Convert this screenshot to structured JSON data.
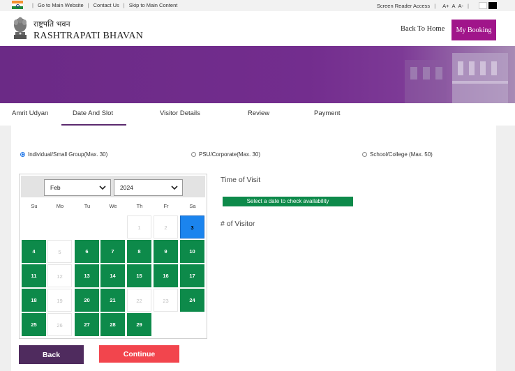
{
  "topbar": {
    "links": [
      "Go to Main Website",
      "Contact Us",
      "Skip to Main Content"
    ],
    "screen_reader": "Screen Reader Access",
    "font_sizes": [
      "A+",
      "A",
      "A-"
    ]
  },
  "header": {
    "brand_hindi": "राष्ट्रपति भवन",
    "brand_english": "RASHTRAPATI BHAVAN",
    "back_home": "Back To Home",
    "my_booking": "My Booking"
  },
  "tabs": [
    {
      "label": "Amrit Udyan",
      "active": false
    },
    {
      "label": "Date And Slot",
      "active": true
    },
    {
      "label": "Visitor Details",
      "active": false
    },
    {
      "label": "Review",
      "active": false
    },
    {
      "label": "Payment",
      "active": false
    }
  ],
  "visitor_types": [
    {
      "label": "Individual/Small Group(Max. 30)",
      "checked": true
    },
    {
      "label": "PSU/Corporate(Max. 30)",
      "checked": false
    },
    {
      "label": "School/College (Max. 50)",
      "checked": false
    }
  ],
  "calendar": {
    "month": "Feb",
    "year": "2024",
    "weekdays": [
      "Su",
      "Mo",
      "Tu",
      "We",
      "Th",
      "Fr",
      "Sa"
    ],
    "days": [
      {
        "day": "1",
        "status": "off",
        "col": 4,
        "row": 0
      },
      {
        "day": "2",
        "status": "off",
        "col": 5,
        "row": 0
      },
      {
        "day": "3",
        "status": "selected",
        "col": 6,
        "row": 0
      },
      {
        "day": "4",
        "status": "available",
        "col": 0,
        "row": 1
      },
      {
        "day": "5",
        "status": "off",
        "col": 1,
        "row": 1
      },
      {
        "day": "6",
        "status": "available",
        "col": 2,
        "row": 1
      },
      {
        "day": "7",
        "status": "available",
        "col": 3,
        "row": 1
      },
      {
        "day": "8",
        "status": "available",
        "col": 4,
        "row": 1
      },
      {
        "day": "9",
        "status": "available",
        "col": 5,
        "row": 1
      },
      {
        "day": "10",
        "status": "available",
        "col": 6,
        "row": 1
      },
      {
        "day": "11",
        "status": "available",
        "col": 0,
        "row": 2
      },
      {
        "day": "12",
        "status": "off",
        "col": 1,
        "row": 2
      },
      {
        "day": "13",
        "status": "available",
        "col": 2,
        "row": 2
      },
      {
        "day": "14",
        "status": "available",
        "col": 3,
        "row": 2
      },
      {
        "day": "15",
        "status": "available",
        "col": 4,
        "row": 2
      },
      {
        "day": "16",
        "status": "available",
        "col": 5,
        "row": 2
      },
      {
        "day": "17",
        "status": "available",
        "col": 6,
        "row": 2
      },
      {
        "day": "18",
        "status": "available",
        "col": 0,
        "row": 3
      },
      {
        "day": "19",
        "status": "off",
        "col": 1,
        "row": 3
      },
      {
        "day": "20",
        "status": "available",
        "col": 2,
        "row": 3
      },
      {
        "day": "21",
        "status": "available",
        "col": 3,
        "row": 3
      },
      {
        "day": "22",
        "status": "off",
        "col": 4,
        "row": 3
      },
      {
        "day": "23",
        "status": "off",
        "col": 5,
        "row": 3
      },
      {
        "day": "24",
        "status": "available",
        "col": 6,
        "row": 3
      },
      {
        "day": "25",
        "status": "available",
        "col": 0,
        "row": 4
      },
      {
        "day": "26",
        "status": "off",
        "col": 1,
        "row": 4
      },
      {
        "day": "27",
        "status": "available",
        "col": 2,
        "row": 4
      },
      {
        "day": "28",
        "status": "available",
        "col": 3,
        "row": 4
      },
      {
        "day": "29",
        "status": "available",
        "col": 4,
        "row": 4
      }
    ]
  },
  "slot": {
    "time_label": "Time of Visit",
    "availability_hint": "Select a date to check availability",
    "visitor_label": "# of Visitor"
  },
  "actions": {
    "back": "Back",
    "continue": "Continue"
  },
  "colors": {
    "brand_purple": "#a0158a",
    "available_green": "#0d8a4a",
    "selected_blue": "#1b84ee",
    "continue_red": "#f2454d",
    "back_purple": "#4f2b5e"
  }
}
